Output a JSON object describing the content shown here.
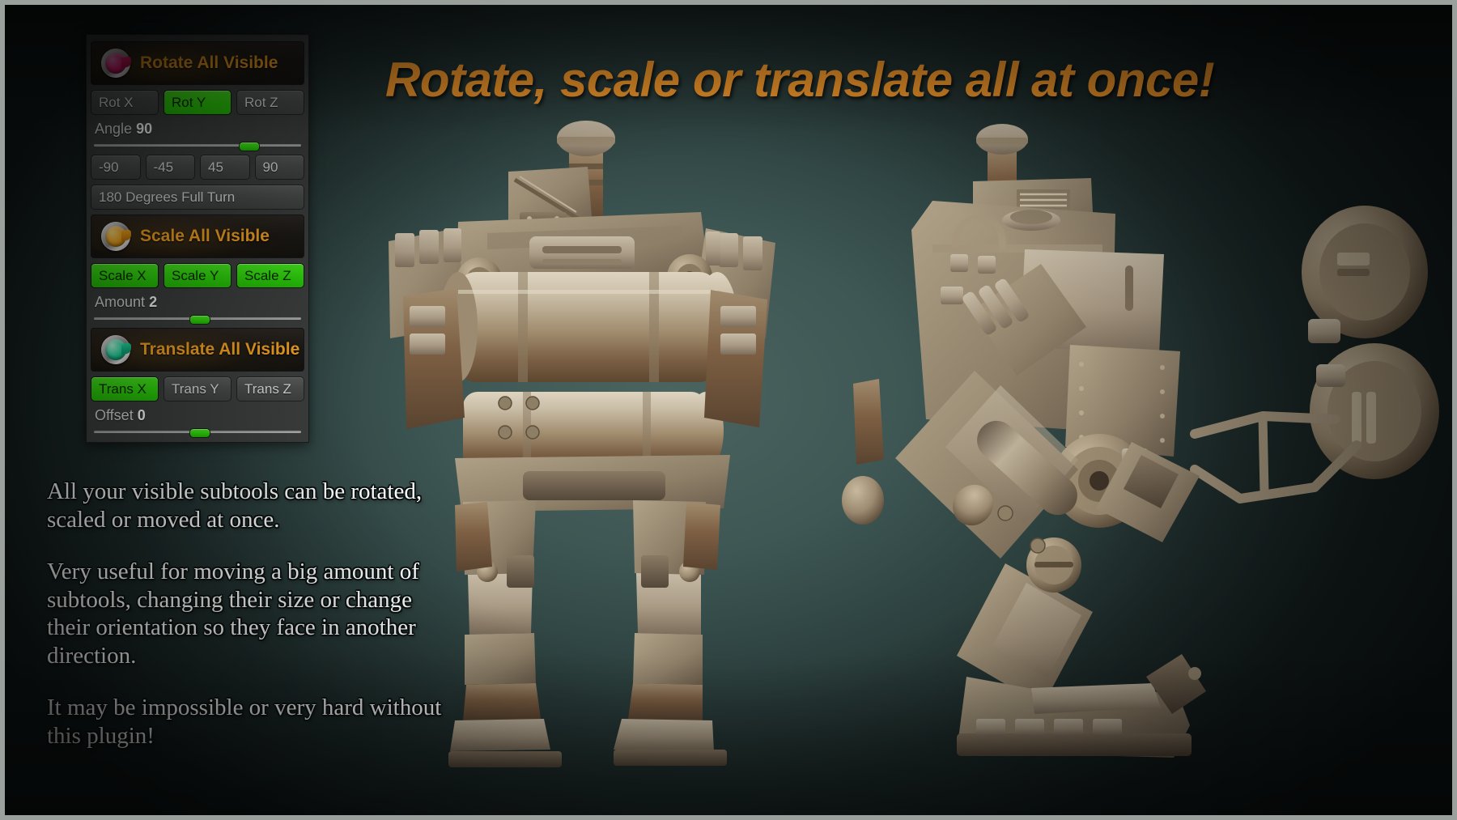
{
  "headline": "Rotate, scale or translate all at once!",
  "panel": {
    "sections": [
      {
        "id": "rotate",
        "icon": "rotate-plugin-knob-icon",
        "title": "Rotate All Visible",
        "axis_buttons": [
          {
            "label": "Rot X",
            "active": false
          },
          {
            "label": "Rot Y",
            "active": true
          },
          {
            "label": "Rot Z",
            "active": false
          }
        ],
        "slider": {
          "label": "Angle",
          "value": "90",
          "fill_percent": 75
        },
        "preset_buttons": [
          {
            "label": "-90"
          },
          {
            "label": "-45"
          },
          {
            "label": "45"
          },
          {
            "label": "90"
          }
        ],
        "full_turn_button": "180 Degrees Full Turn"
      },
      {
        "id": "scale",
        "icon": "scale-plugin-knob-icon",
        "title": "Scale All Visible",
        "axis_buttons": [
          {
            "label": "Scale X",
            "active": true
          },
          {
            "label": "Scale Y",
            "active": true
          },
          {
            "label": "Scale Z",
            "active": true
          }
        ],
        "slider": {
          "label": "Amount",
          "value": "2",
          "fill_percent": 50
        }
      },
      {
        "id": "translate",
        "icon": "translate-plugin-knob-icon",
        "title": "Translate All Visible",
        "axis_buttons": [
          {
            "label": "Trans X",
            "active": true
          },
          {
            "label": "Trans Y",
            "active": false
          },
          {
            "label": "Trans Z",
            "active": false
          }
        ],
        "slider": {
          "label": "Offset",
          "value": "0",
          "fill_percent": 50
        }
      }
    ]
  },
  "description": {
    "paragraphs": [
      "All your visible subtools can be rotated, scaled or moved at once.",
      "Very useful for moving a big amount of subtools, changing their size or change their orientation so they face in another direction.",
      "It may be impossible or very hard without this plugin!"
    ]
  },
  "viewport": {
    "label": "3d-model-viewport",
    "models": [
      {
        "name": "mech-robot-front-view"
      },
      {
        "name": "mech-robot-side-view"
      }
    ]
  },
  "colors": {
    "accent_orange": "#f79a2b",
    "header_gold": "#f4a322",
    "active_green": "#2ed40c",
    "panel_grey": "#3c3f3e",
    "background_teal": "#3e5754"
  }
}
